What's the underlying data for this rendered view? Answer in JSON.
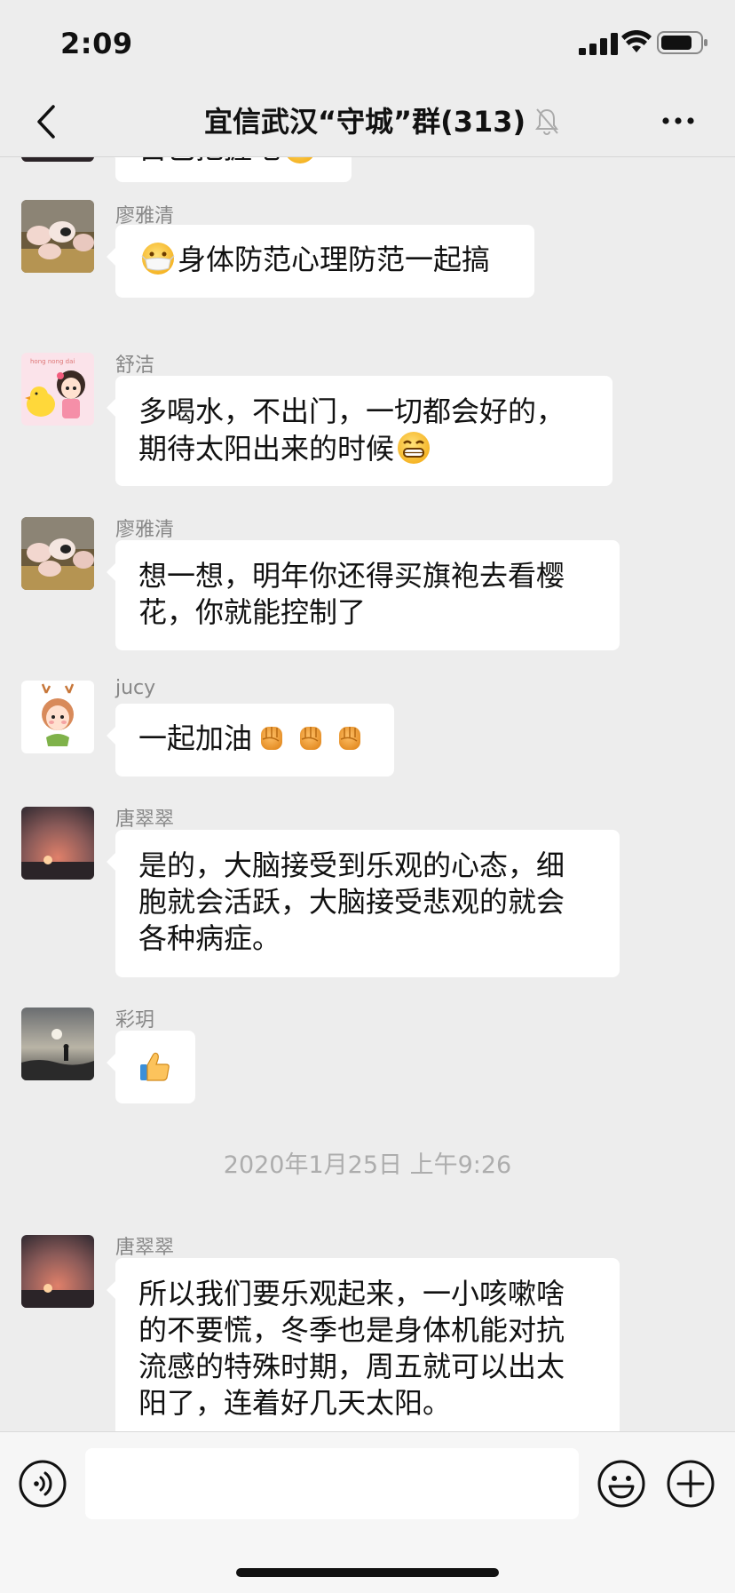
{
  "status_bar": {
    "time": "2:09"
  },
  "nav": {
    "title": "宜信武汉“守城”群(313)",
    "icons": [
      "chevron-left-icon",
      "mute-bell-icon",
      "more-dots-icon"
    ]
  },
  "messages": [
    {
      "sender": "",
      "lines": [
        "自己把握吧"
      ],
      "avatar": "sunset-avatar",
      "emoji": "crying-laughing"
    },
    {
      "sender": "廖雅清",
      "lines": [
        "身体防范心理防范一起搞"
      ],
      "avatar": "pigs-avatar",
      "emoji": "mask-face"
    },
    {
      "sender": "舒洁",
      "lines": [
        "多喝水，不出门，一切都会好的，",
        "期待太阳出来的时候"
      ],
      "avatar": "cartoon-girl-duck-avatar",
      "emoji": "grinning-face"
    },
    {
      "sender": "廖雅清",
      "lines": [
        "想一想，明年你还得买旗袍去看樱",
        "花，你就能控制了"
      ],
      "avatar": "pigs-avatar"
    },
    {
      "sender": "jucy",
      "lines": [
        "一起加油"
      ],
      "avatar": "deer-girl-avatar",
      "emoji": "raised-fist x3"
    },
    {
      "sender": "唐翠翠",
      "lines": [
        "是的，大脑接受到乐观的心态，细",
        "胞就会活跃，大脑接受悲观的就会",
        "各种病症。"
      ],
      "avatar": "sunset-avatar"
    },
    {
      "sender": "彩玥",
      "lines": [],
      "avatar": "seaside-avatar",
      "emoji": "thumbs-up"
    },
    {
      "sender": "唐翠翠",
      "lines": [
        "所以我们要乐观起来，一小咳嗽啥",
        "的不要慌，冬季也是身体机能对抗",
        "流感的特殊时期，周五就可以出太",
        "阳了，连着好几天太阳。"
      ],
      "avatar": "sunset-avatar"
    }
  ],
  "timestamp": "2020年1月25日 上午9:26",
  "input_bar": {
    "placeholder": "",
    "icons": [
      "voice-icon",
      "emoji-icon",
      "plus-icon"
    ]
  }
}
